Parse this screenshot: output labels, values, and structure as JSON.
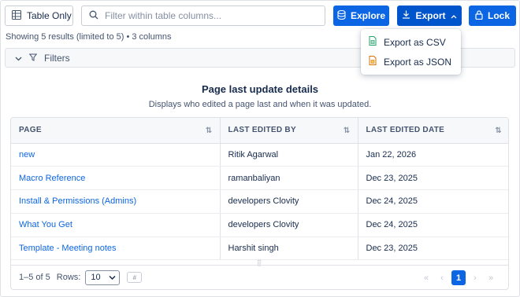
{
  "toolbar": {
    "view_label": "Table Only",
    "search_placeholder": "Filter within table columns...",
    "explore_label": "Explore",
    "export_label": "Export",
    "lock_label": "Lock"
  },
  "summary": "Showing 5 results (limited to 5) • 3 columns",
  "filters_label": "Filters",
  "export_menu": {
    "items": [
      "Export as CSV",
      "Export as JSON"
    ]
  },
  "report": {
    "title": "Page last update details",
    "subtitle": "Displays who edited a page last and when it was updated."
  },
  "table": {
    "headers": [
      "PAGE",
      "LAST EDITED BY",
      "LAST EDITED DATE"
    ],
    "rows": [
      [
        "new",
        "Ritik Agarwal",
        "Jan 22, 2026"
      ],
      [
        "Macro Reference",
        "ramanbaliyan",
        "Dec 23, 2025"
      ],
      [
        "Install & Permissions (Admins)",
        "developers Clovity",
        "Dec 24, 2025"
      ],
      [
        "What You Get",
        "developers Clovity",
        "Dec 24, 2025"
      ],
      [
        "Template - Meeting notes",
        "Harshit singh",
        "Dec 23, 2025"
      ]
    ]
  },
  "footer": {
    "range": "1–5 of 5",
    "rows_label": "Rows:",
    "rows_value": "10",
    "current_page": "1"
  },
  "colors": {
    "primary": "#0c66e4",
    "link": "#0c66e4",
    "csv_icon": "#22a06b",
    "json_icon": "#e2b203"
  }
}
